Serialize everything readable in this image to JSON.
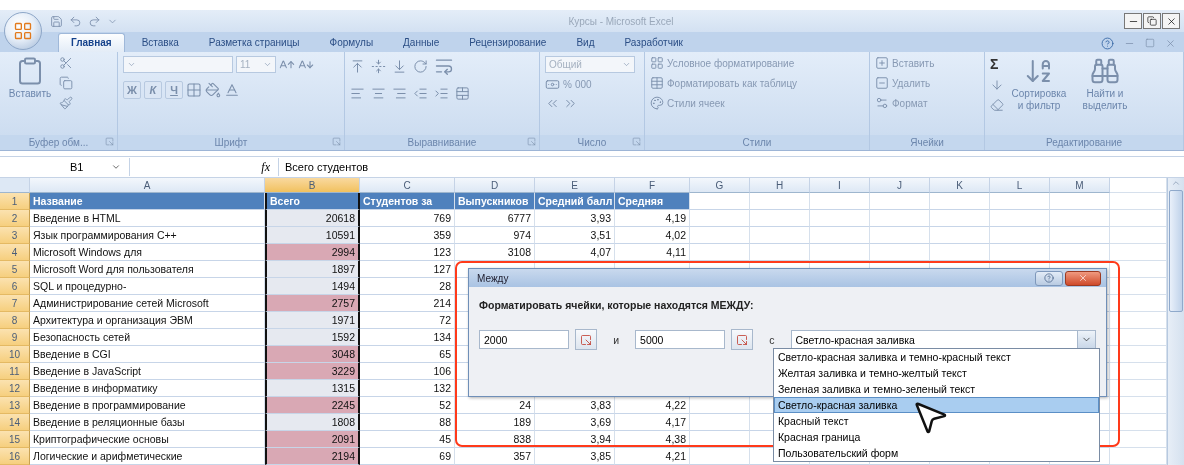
{
  "window": {
    "title": "Курсы - Microsoft Excel"
  },
  "tabs": [
    {
      "label": "Главная",
      "selected": true
    },
    {
      "label": "Вставка",
      "selected": false
    },
    {
      "label": "Разметка страницы",
      "selected": false
    },
    {
      "label": "Формулы",
      "selected": false
    },
    {
      "label": "Данные",
      "selected": false
    },
    {
      "label": "Рецензирование",
      "selected": false
    },
    {
      "label": "Вид",
      "selected": false
    },
    {
      "label": "Разработчик",
      "selected": false
    }
  ],
  "ribbon": [
    {
      "kind": "clipboard",
      "label": "Буфер обм...",
      "paste": "Вставить"
    },
    {
      "kind": "font",
      "label": "Шрифт",
      "size": "11",
      "styles": [
        "Ж",
        "К",
        "Ч"
      ]
    },
    {
      "kind": "alignment",
      "label": "Выравнивание"
    },
    {
      "kind": "number",
      "label": "Число",
      "format": "Общий",
      "buttons": [
        "%",
        "000"
      ]
    },
    {
      "kind": "styles",
      "label": "Стили",
      "commands": [
        "Условное форматирование",
        "Форматировать как таблицу",
        "Стили ячеек"
      ]
    },
    {
      "kind": "cells",
      "label": "Ячейки",
      "commands": [
        "Вставить",
        "Удалить",
        "Формат"
      ]
    },
    {
      "kind": "editing",
      "label": "Редактирование",
      "sigma": "Σ",
      "commands": [
        "Сортировка и фильтр",
        "Найти и выделить"
      ]
    }
  ],
  "formula_bar": {
    "name_box": "B1",
    "fx": "fx",
    "value": "Всего студентов"
  },
  "columns": [
    {
      "label": "A",
      "selected": false
    },
    {
      "label": "B",
      "selected": true
    },
    {
      "label": "C",
      "selected": false
    },
    {
      "label": "D",
      "selected": false
    },
    {
      "label": "E",
      "selected": false
    },
    {
      "label": "F",
      "selected": false
    },
    {
      "label": "G",
      "selected": false
    },
    {
      "label": "H",
      "selected": false
    },
    {
      "label": "I",
      "selected": false
    },
    {
      "label": "J",
      "selected": false
    },
    {
      "label": "K",
      "selected": false
    },
    {
      "label": "L",
      "selected": false
    },
    {
      "label": "M",
      "selected": false
    }
  ],
  "rows": [
    {
      "num": "1",
      "kind": "header",
      "cells": [
        "Название",
        "Всего",
        "Студентов за",
        "Выпускников",
        "Средний балл",
        "Средняя"
      ]
    },
    {
      "num": "2",
      "kind": "data",
      "highlighted": false,
      "cells": [
        "Введение в HTML",
        "20618",
        "769",
        "6777",
        "3,93",
        "4,19"
      ]
    },
    {
      "num": "3",
      "kind": "data",
      "highlighted": false,
      "cells": [
        "Язык программирования C++",
        "10591",
        "359",
        "974",
        "3,51",
        "4,02"
      ]
    },
    {
      "num": "4",
      "kind": "data",
      "highlighted": true,
      "cells": [
        "Microsoft Windows для",
        "2994",
        "123",
        "3108",
        "4,07",
        "4,11"
      ]
    },
    {
      "num": "5",
      "kind": "data",
      "highlighted": false,
      "cells": [
        "Microsoft Word для пользователя",
        "1897",
        "127"
      ]
    },
    {
      "num": "6",
      "kind": "data",
      "highlighted": false,
      "cells": [
        "SQL и процедурно-",
        "1494",
        "28"
      ]
    },
    {
      "num": "7",
      "kind": "data",
      "highlighted": true,
      "cells": [
        "Администрирование сетей Microsoft",
        "2757",
        "214"
      ]
    },
    {
      "num": "8",
      "kind": "data",
      "highlighted": false,
      "cells": [
        "Архитектура и организация ЭВМ",
        "1971",
        "72"
      ]
    },
    {
      "num": "9",
      "kind": "data",
      "highlighted": false,
      "cells": [
        "Безопасность сетей",
        "1592",
        "134"
      ]
    },
    {
      "num": "10",
      "kind": "data",
      "highlighted": true,
      "cells": [
        "Введение в CGI",
        "3048",
        "65"
      ]
    },
    {
      "num": "11",
      "kind": "data",
      "highlighted": true,
      "cells": [
        "Введение в JavaScript",
        "3229",
        "106"
      ]
    },
    {
      "num": "12",
      "kind": "data",
      "highlighted": false,
      "cells": [
        "Введение в информатику",
        "1315",
        "132"
      ]
    },
    {
      "num": "13",
      "kind": "data",
      "highlighted": true,
      "cells": [
        "Введение в программирование",
        "2245",
        "52",
        "24",
        "3,83",
        "4,22"
      ]
    },
    {
      "num": "14",
      "kind": "data",
      "highlighted": false,
      "cells": [
        "Введение в реляционные базы",
        "1808",
        "88",
        "189",
        "3,69",
        "4,17"
      ]
    },
    {
      "num": "15",
      "kind": "data",
      "highlighted": true,
      "cells": [
        "Криптографические основы",
        "2091",
        "45",
        "838",
        "3,94",
        "4,38"
      ]
    },
    {
      "num": "16",
      "kind": "data",
      "highlighted": true,
      "cells": [
        "Логические и арифметические",
        "2194",
        "69",
        "357",
        "3,85",
        "4,21"
      ]
    }
  ],
  "dialog": {
    "title": "Между",
    "prompt": "Форматировать ячейки, которые находятся МЕЖДУ:",
    "from": "2000",
    "and": "и",
    "to": "5000",
    "with": "с",
    "format": "Светло-красная заливка",
    "options": [
      {
        "label": "Светло-красная заливка и темно-красный текст",
        "selected": false
      },
      {
        "label": "Желтая заливка и темно-желтый текст",
        "selected": false
      },
      {
        "label": "Зеленая заливка и темно-зеленый текст",
        "selected": false
      },
      {
        "label": "Светло-красная заливка",
        "selected": true
      },
      {
        "label": "Красный текст",
        "selected": false
      },
      {
        "label": "Красная граница",
        "selected": false
      },
      {
        "label": "Пользовательский форм",
        "selected": false
      }
    ]
  }
}
